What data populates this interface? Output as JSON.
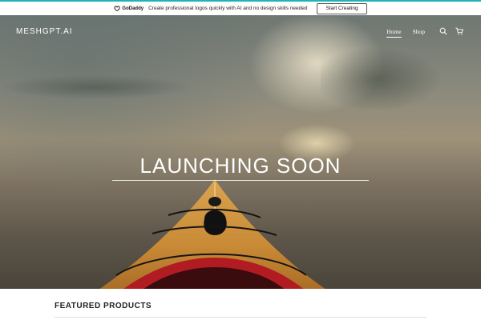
{
  "promo": {
    "brand": "GoDaddy",
    "message": "Create professional logos quickly with AI and no design skills needed",
    "cta_label": "Start Creating",
    "accent_color": "#1bb4b9"
  },
  "header": {
    "site_title": "MESHGPT.AI",
    "nav": [
      {
        "label": "Home",
        "active": true
      },
      {
        "label": "Shop",
        "active": false
      }
    ],
    "icons": [
      "search-icon",
      "cart-icon"
    ]
  },
  "hero": {
    "headline": "LAUNCHING SOON"
  },
  "featured": {
    "title": "FEATURED PRODUCTS"
  }
}
